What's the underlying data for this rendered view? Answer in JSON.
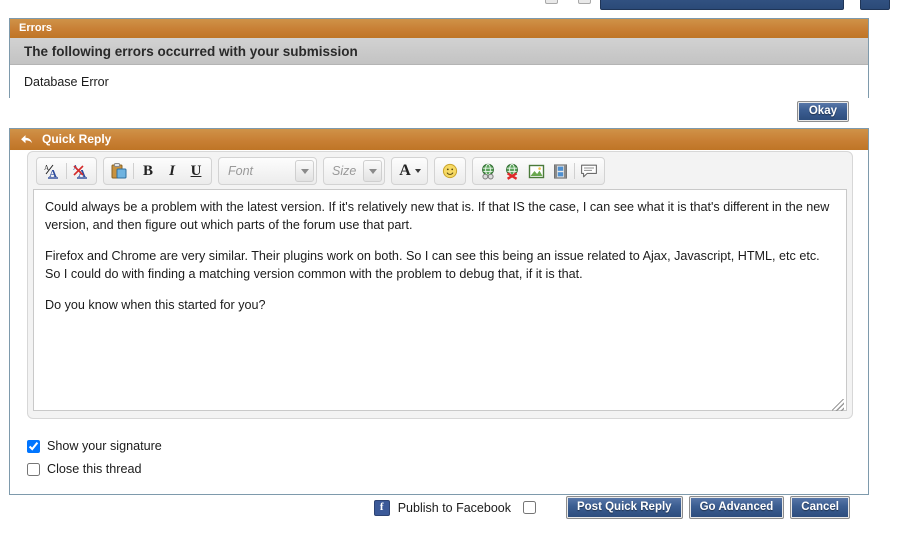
{
  "errors": {
    "title": "Errors",
    "subheading": "The following errors occurred with your submission",
    "messages": [
      "Database Error"
    ],
    "okay_label": "Okay"
  },
  "quick_reply": {
    "title": "Quick Reply",
    "reply_icon": "reply-arrow-icon",
    "toolbar": {
      "remove_format_label": "A",
      "toggle_editor_label": "A",
      "paste_label": "📋",
      "bold_label": "B",
      "italic_label": "I",
      "underline_label": "U",
      "font_placeholder": "Font",
      "size_placeholder": "Size",
      "font_color_label": "A",
      "smilie_label": "☺",
      "insert_link_label": "🌐",
      "remove_link_label": "🌐",
      "insert_image_label": "🖼",
      "insert_video_label": "🎞",
      "quote_label": "💬"
    },
    "message_paragraphs": [
      "Could always be a problem with the latest version. If it's relatively new that is. If that IS the case, I can see what it is that's different in the new version, and then figure out which parts of the forum use that part.",
      "Firefox and Chrome are very similar. Their plugins work on both. So I can see this being an issue related to Ajax, Javascript, HTML, etc etc. So I could do with finding a matching version common with the problem to debug that, if it is that.",
      "Do you know when this started for you?"
    ],
    "options": [
      {
        "label": "Show your signature",
        "checked": true
      },
      {
        "label": "Close this thread",
        "checked": false
      }
    ]
  },
  "footer": {
    "facebook_label": "Publish to Facebook",
    "facebook_icon": "facebook-icon",
    "facebook_checked": false,
    "post_label": "Post Quick Reply",
    "advanced_label": "Go Advanced",
    "cancel_label": "Cancel"
  },
  "colors": {
    "title_orange": "#c87f34",
    "panel_border": "#7e9aac",
    "button_blue": "#3c5e92",
    "subheader_gray": "#c9c9c9"
  }
}
